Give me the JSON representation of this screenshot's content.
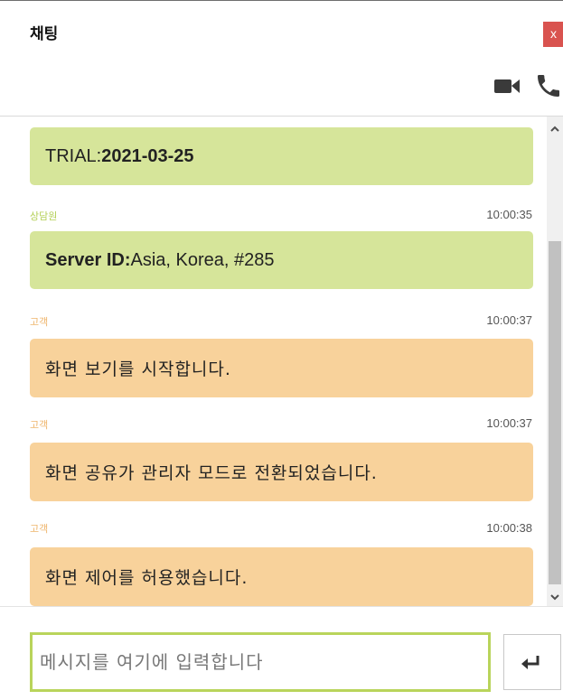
{
  "header": {
    "title": "채팅",
    "close_label": "x",
    "video_icon": "video-camera-icon",
    "phone_icon": "phone-icon"
  },
  "messages": [
    {
      "sender": "",
      "time": "",
      "type": "system",
      "label": "TRIAL: ",
      "value": "2021-03-25"
    },
    {
      "sender": "상담원",
      "time": "10:00:35",
      "type": "agent",
      "label": "Server ID:",
      "value": "Asia, Korea, #285"
    },
    {
      "sender": "고객",
      "time": "10:00:37",
      "type": "customer",
      "text": "화면 보기를 시작합니다."
    },
    {
      "sender": "고객",
      "time": "10:00:37",
      "type": "customer",
      "text": "화면 공유가 관리자 모드로 전환되었습니다."
    },
    {
      "sender": "고객",
      "time": "10:00:38",
      "type": "customer",
      "text": "화면 제어를 허용했습니다."
    }
  ],
  "input": {
    "placeholder": "메시지를 여기에 입력합니다",
    "value": ""
  },
  "send_button": {
    "icon": "enter-return-icon"
  },
  "colors": {
    "agent_bubble": "#d6e59a",
    "customer_bubble": "#f8d29b",
    "input_border": "#b9d45b",
    "close_button": "#d9534f"
  }
}
